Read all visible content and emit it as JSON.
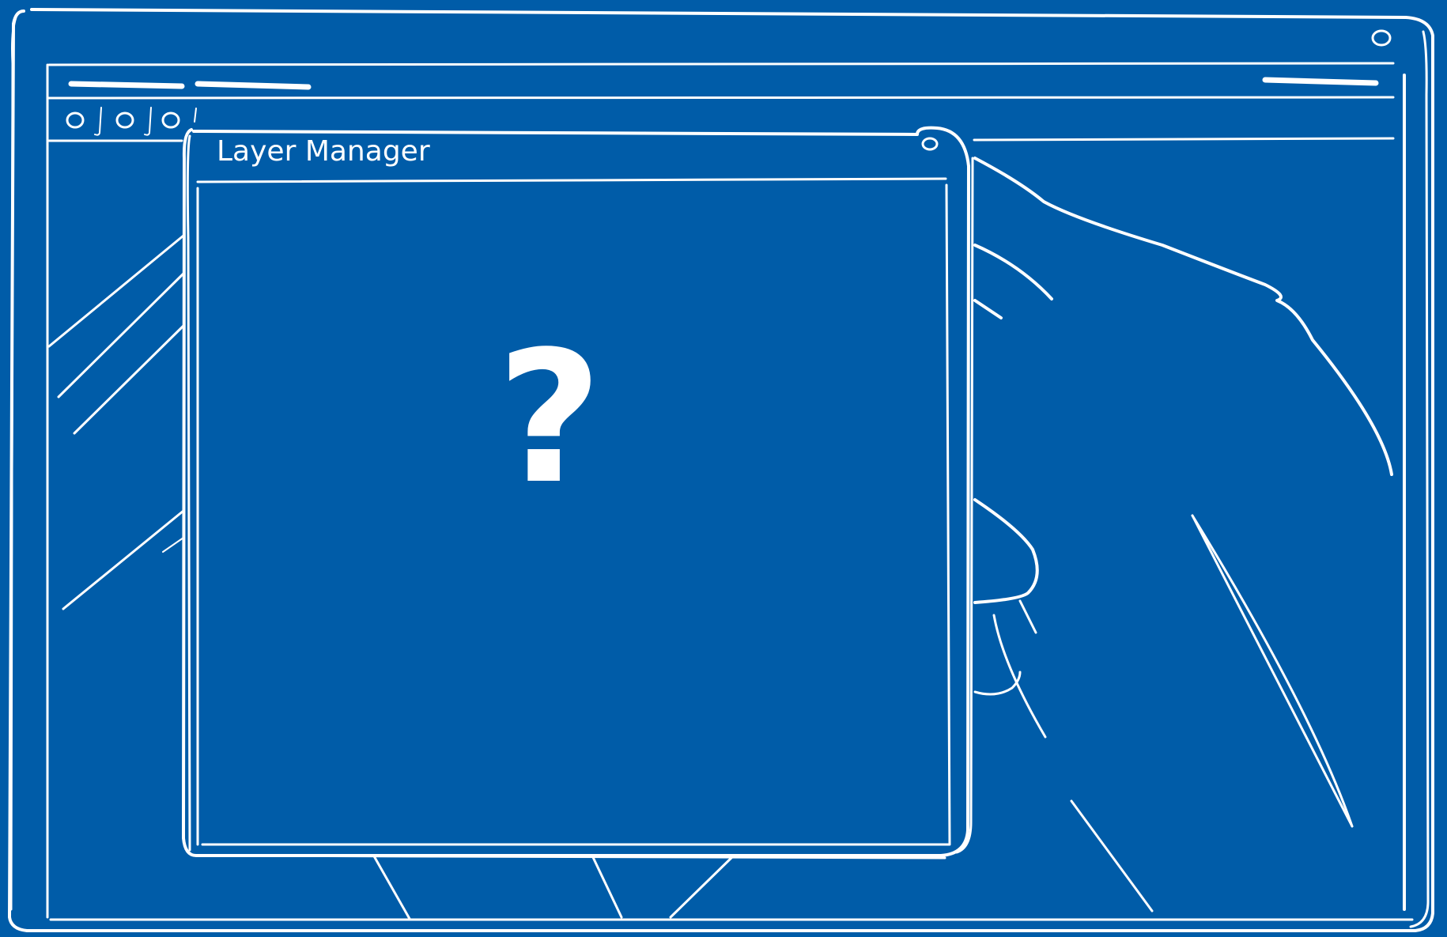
{
  "window": {
    "title_placeholder": "",
    "toolbar_icons": [
      "circle-icon",
      "circle-icon",
      "circle-icon"
    ]
  },
  "dialog": {
    "title": "Layer Manager",
    "content_symbol": "?",
    "close_icon": "circle-icon"
  },
  "colors": {
    "background": "#005ca8",
    "stroke": "#ffffff"
  }
}
